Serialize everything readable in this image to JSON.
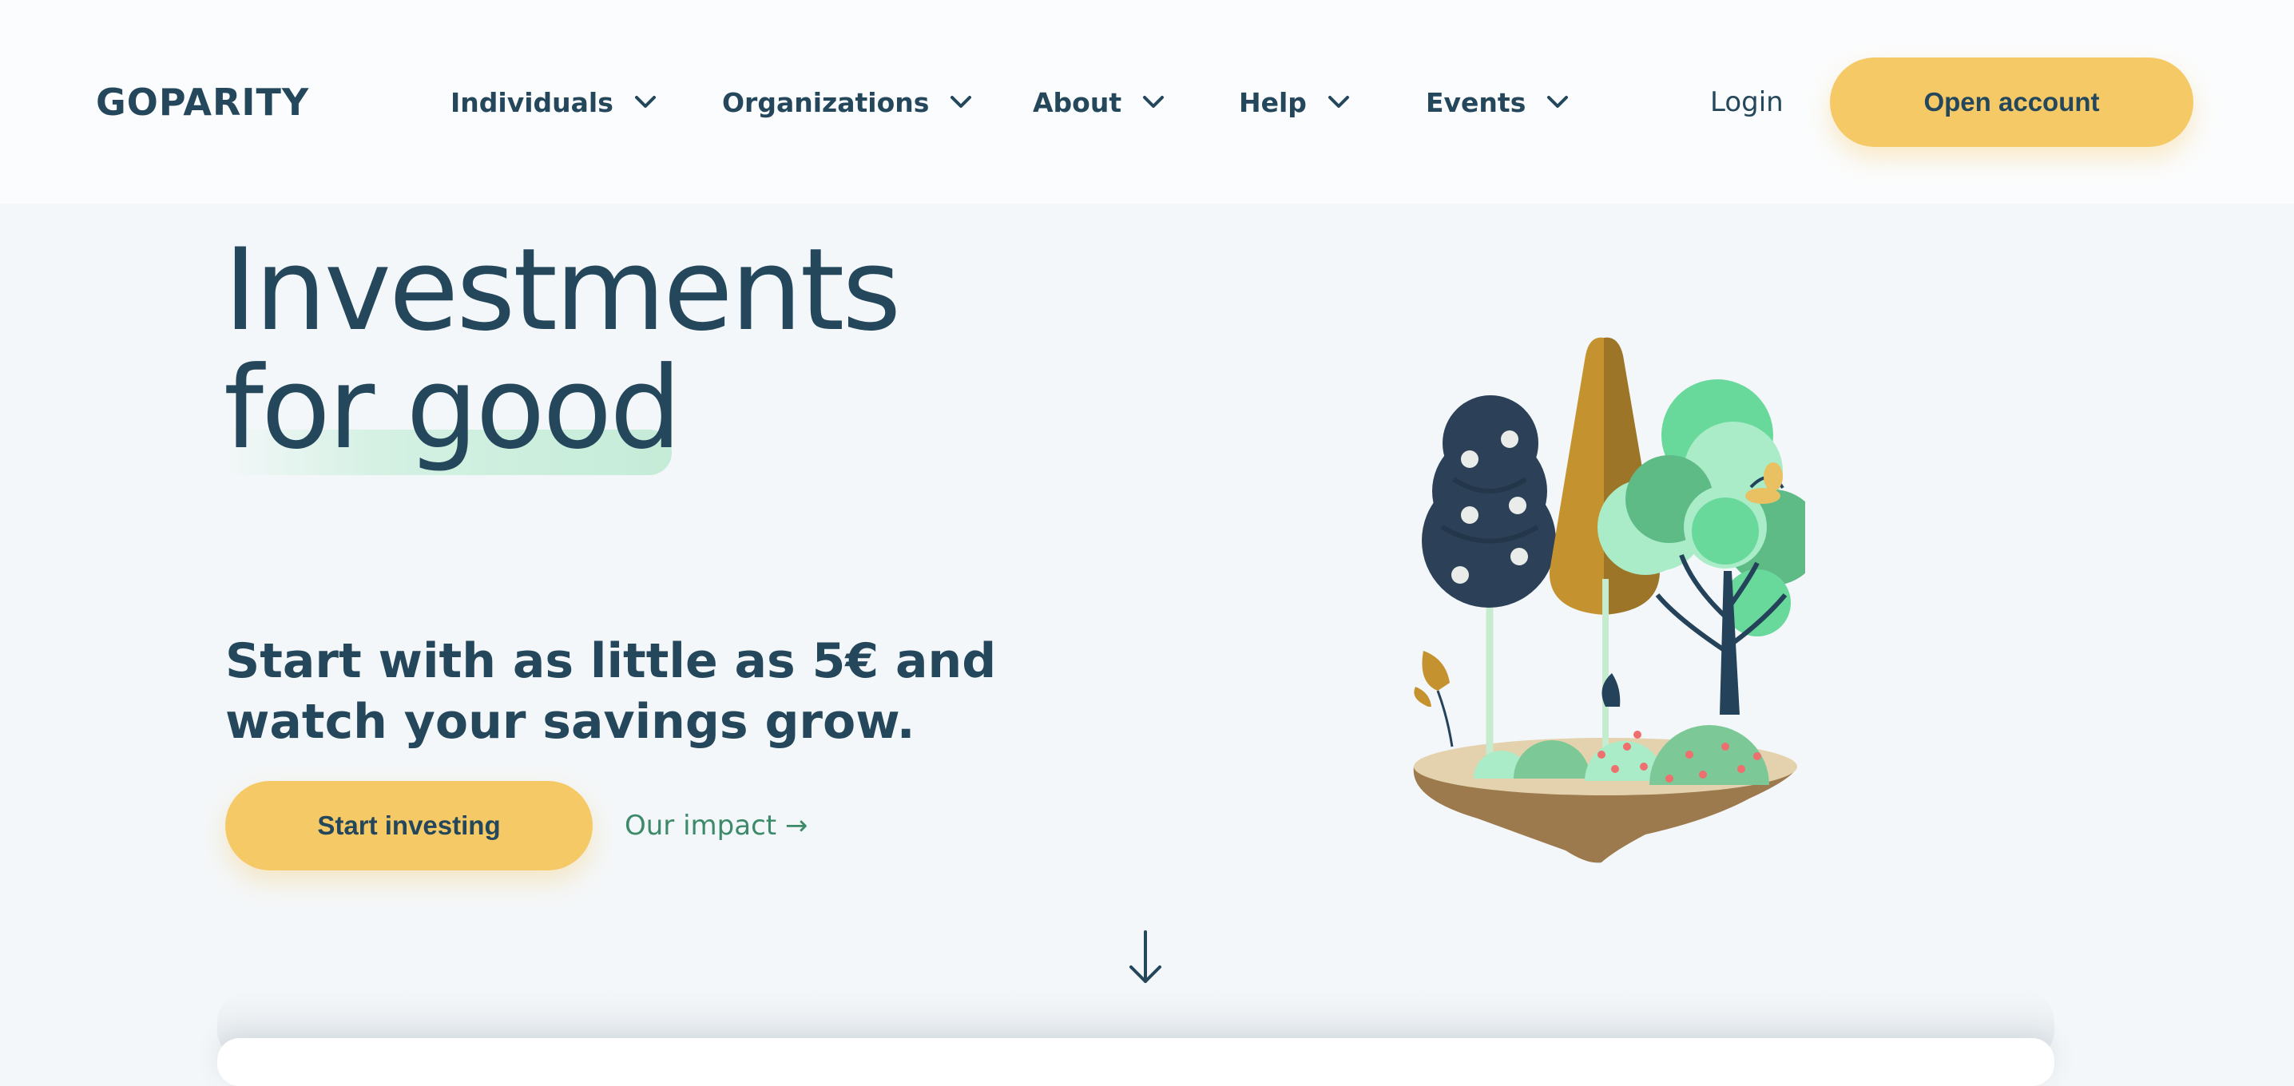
{
  "header": {
    "logo": "GOPARITY",
    "nav": [
      {
        "label": "Individuals"
      },
      {
        "label": "Organizations"
      },
      {
        "label": "About"
      },
      {
        "label": "Help"
      },
      {
        "label": "Events"
      }
    ],
    "login_label": "Login",
    "open_account_label": "Open account"
  },
  "hero": {
    "title_line1": "Investments",
    "title_line2": "for good",
    "subtitle": "Start with as little as 5€ and watch your savings grow.",
    "start_investing_label": "Start investing",
    "impact_link_label": "Our impact →"
  },
  "icons": {
    "nav_chevron": "chevron-down-icon",
    "scroll": "arrow-down-icon"
  },
  "colors": {
    "brand_text": "#24475c",
    "accent_yellow": "#f5c965",
    "link_green": "#3c8a6a",
    "highlight_green": "#c5ecd8",
    "background": "#f4f7f9",
    "header_bg": "#fbfcfd"
  }
}
